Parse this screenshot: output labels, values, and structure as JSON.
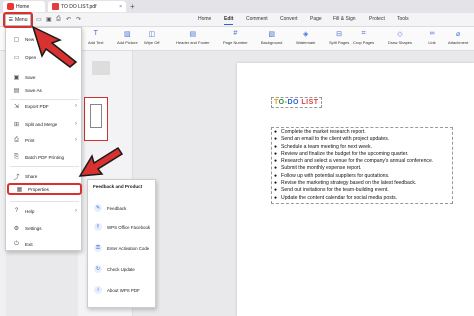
{
  "titlebar": {
    "home_tab": "Home",
    "file_tab": "TO DO LIST.pdf",
    "file_close": "×",
    "home_close": "×",
    "new_tab": "+"
  },
  "menurow": {
    "menu_label": "Menu",
    "tabs": [
      "Home",
      "Edit",
      "Comment",
      "Convert",
      "Page",
      "Fill & Sign",
      "Protect",
      "Tools"
    ],
    "active_tab": "Edit"
  },
  "toolbar": {
    "tools": [
      "Add Text",
      "Add Picture",
      "Wipe Off",
      "Header and Footer",
      "Page Number",
      "Background",
      "Watermark",
      "Split Pages",
      "Crop Pages",
      "Draw Shapes",
      "Link",
      "Attachment"
    ]
  },
  "dropdown": {
    "items": [
      {
        "label": "New",
        "icon": "new-file-icon",
        "arrow": false
      },
      {
        "label": "Open",
        "icon": "folder-icon",
        "arrow": false
      },
      {
        "label": "Save",
        "icon": "save-icon",
        "arrow": false
      },
      {
        "label": "Save As",
        "icon": "save-as-icon",
        "arrow": false
      },
      {
        "label": "Export PDF",
        "icon": "export-icon",
        "arrow": true
      },
      {
        "label": "Split and Merge",
        "icon": "split-merge-icon",
        "arrow": true
      },
      {
        "label": "Print",
        "icon": "printer-icon",
        "arrow": true
      },
      {
        "label": "Batch PDF Printing",
        "icon": "batch-print-icon",
        "arrow": false
      },
      {
        "label": "Share",
        "icon": "share-icon",
        "arrow": false
      },
      {
        "label": "Properties",
        "icon": "properties-icon",
        "arrow": false
      },
      {
        "label": "Help",
        "icon": "help-icon",
        "arrow": true
      },
      {
        "label": "Settings",
        "icon": "settings-icon",
        "arrow": false
      },
      {
        "label": "Exit",
        "icon": "exit-icon",
        "arrow": false
      }
    ]
  },
  "submenu": {
    "heading": "Feedback and Product",
    "items": [
      "Feedback",
      "WPS Office Facebook",
      "Enter Activation Code",
      "Check Update",
      "About WPS PDF"
    ]
  },
  "document": {
    "title_parts": [
      "T",
      "O-",
      "DO ",
      "LIST"
    ],
    "items": [
      "Complete the market research report.",
      "Send an email to the client with project updates.",
      "Schedule a team meeting for next week.",
      "Review and finalize the budget for the upcoming quarter.",
      "Research and select a venue for the company's annual conference.",
      "Submit the monthly expense report.",
      "Follow up with potential suppliers for quotations.",
      "Revise the marketing strategy based on the latest feedback.",
      "Send out invitations for the team-building event.",
      "Update the content calendar for social media posts."
    ]
  },
  "colors": {
    "accent": "#2b62d6",
    "highlight_red": "#d93030"
  }
}
